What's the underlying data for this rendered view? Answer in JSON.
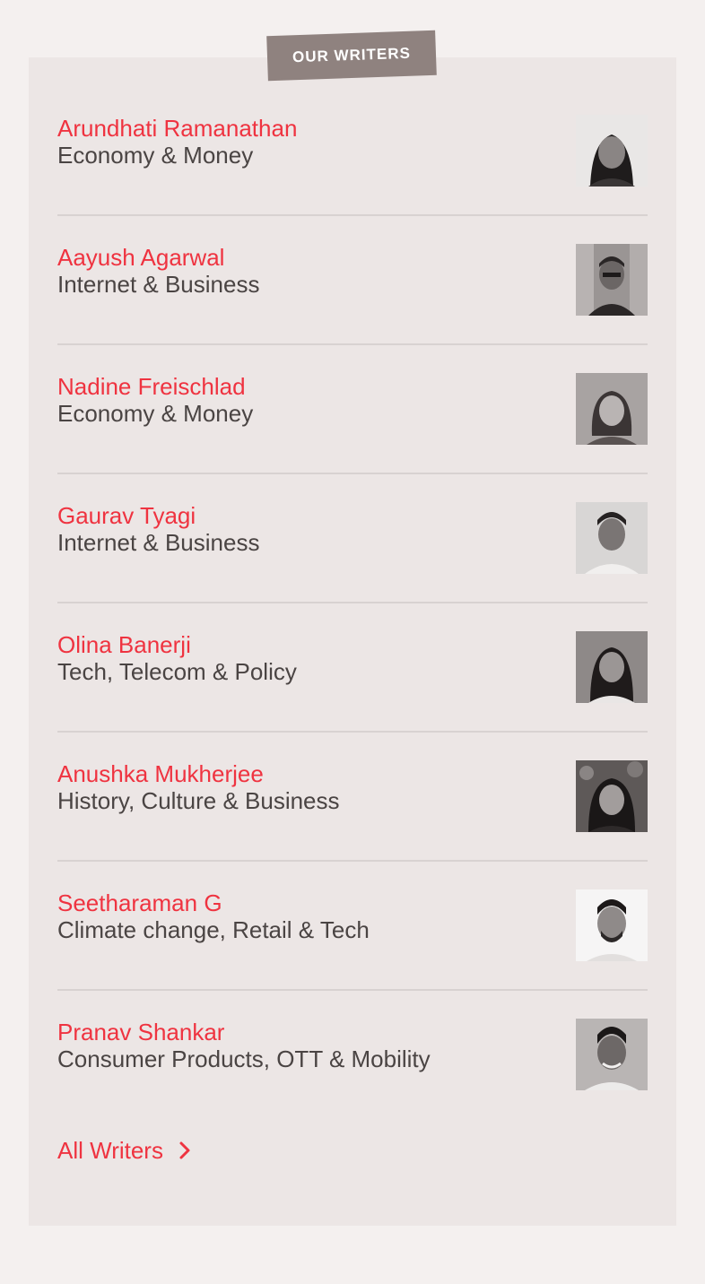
{
  "section_label": "OUR WRITERS",
  "writers": [
    {
      "name": "Arundhati Ramanathan",
      "beat": "Economy & Money",
      "avatar_icon": "portrait-photo"
    },
    {
      "name": "Aayush Agarwal",
      "beat": "Internet & Business",
      "avatar_icon": "portrait-photo"
    },
    {
      "name": "Nadine Freischlad",
      "beat": "Economy & Money",
      "avatar_icon": "portrait-photo"
    },
    {
      "name": "Gaurav Tyagi",
      "beat": "Internet & Business",
      "avatar_icon": "portrait-photo"
    },
    {
      "name": "Olina Banerji",
      "beat": "Tech, Telecom & Policy",
      "avatar_icon": "portrait-photo"
    },
    {
      "name": "Anushka Mukherjee",
      "beat": "History, Culture & Business",
      "avatar_icon": "portrait-photo"
    },
    {
      "name": "Seetharaman G",
      "beat": "Climate change, Retail & Tech",
      "avatar_icon": "portrait-photo"
    },
    {
      "name": "Pranav Shankar",
      "beat": "Consumer Products, OTT & Mobility",
      "avatar_icon": "portrait-photo"
    }
  ],
  "all_writers_link": {
    "label": "All Writers",
    "icon": "chevron-right-icon"
  },
  "colors": {
    "accent": "#ef3340",
    "badge_bg": "#8f827f",
    "card_bg": "#ece6e5",
    "page_bg": "#f4f0ef",
    "text": "#4a4443"
  }
}
